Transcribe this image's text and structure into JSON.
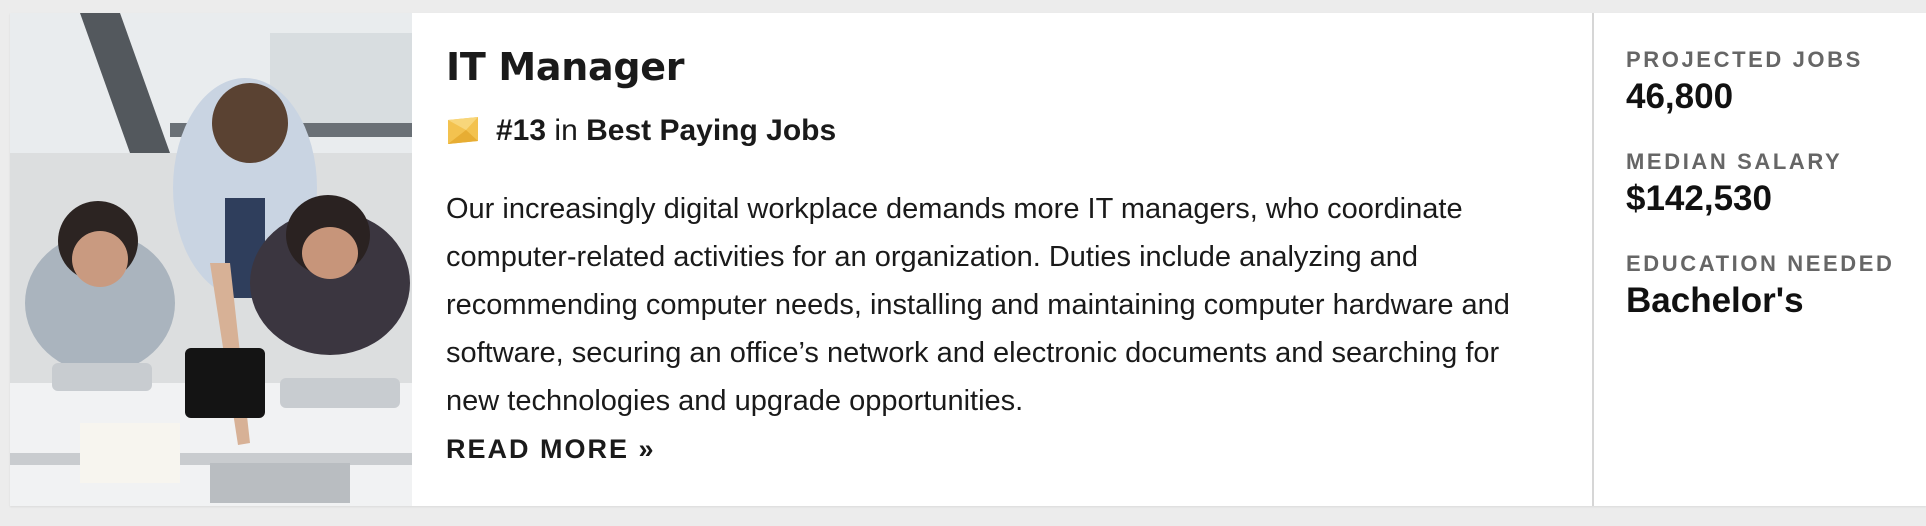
{
  "job": {
    "title": "IT Manager",
    "rank": {
      "number": "#13",
      "connector": "in",
      "list_name": "Best Paying Jobs",
      "badge_icon": "ribbon-badge-icon",
      "badge_color": "#f3c24f"
    },
    "description": "Our increasingly digital workplace demands more IT managers, who coordinate computer-related activities for an organization. Duties include analyzing and recommending computer needs, installing and maintaining computer hardware and software, securing an office’s network and electronic documents and searching for new technologies and upgrade opportunities.",
    "read_more_label": "READ MORE »"
  },
  "stats": [
    {
      "label": "PROJECTED JOBS",
      "value": "46,800"
    },
    {
      "label": "MEDIAN SALARY",
      "value": "$142,530"
    },
    {
      "label": "EDUCATION NEEDED",
      "value": "Bachelor's"
    }
  ]
}
